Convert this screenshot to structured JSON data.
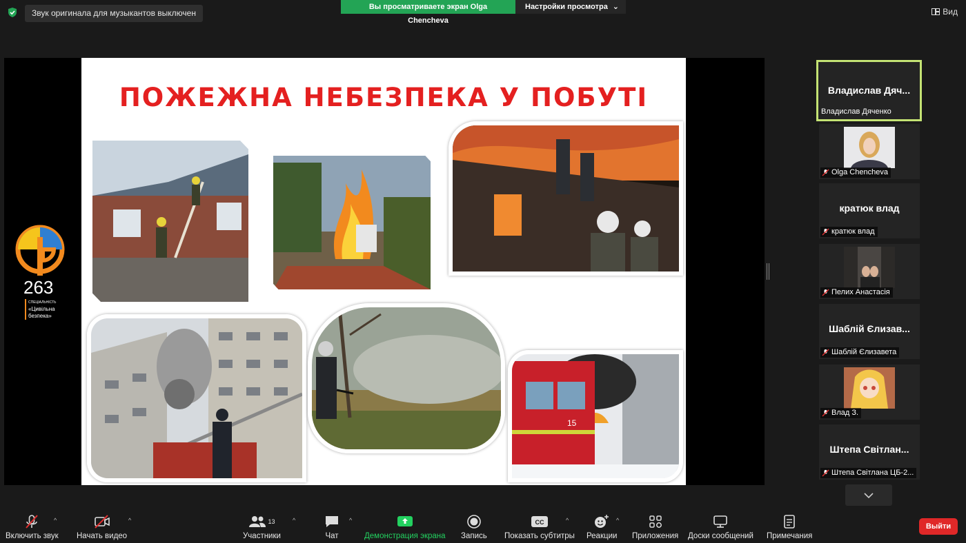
{
  "top": {
    "notice": "Звук оригинала для музыкантов выключен",
    "sharing_banner": "Вы просматриваете экран Olga Chencheva",
    "view_options": "Настройки просмотра",
    "view_button": "Вид"
  },
  "slide": {
    "title": "ПОЖЕЖНА НЕБЕЗПЕКА У ПОБУТІ",
    "logo_number": "263",
    "logo_line1": "СПЕЦІАЛЬНІСТЬ",
    "logo_line2": "«Цивільна",
    "logo_line3": "безпека»",
    "truck_number": "15"
  },
  "participants": [
    {
      "center": "Владислав Дяч...",
      "label": "Владислав Дяченко",
      "active": true,
      "muted": false
    },
    {
      "center": "",
      "label": "Olga Chencheva",
      "muted": true
    },
    {
      "center": "кратюк влад",
      "label": "кратюк влад",
      "muted": true
    },
    {
      "center": "",
      "label": "Пелих Анастасія",
      "muted": true
    },
    {
      "center": "Шаблій Єлизав...",
      "label": "Шаблій Єлизавета",
      "muted": true
    },
    {
      "center": "",
      "label": "Влад З.",
      "muted": true
    },
    {
      "center": "Штепа Світлан...",
      "label": "Штепа Світлана ЦБ-2...",
      "muted": true
    }
  ],
  "toolbar": {
    "unmute": "Включить звук",
    "start_video": "Начать видео",
    "participants": "Участники",
    "participants_count": "13",
    "chat": "Чат",
    "share_screen": "Демонстрация экрана",
    "record": "Запись",
    "captions": "Показать субтитры",
    "cc": "CC",
    "reactions": "Реакции",
    "apps": "Приложения",
    "whiteboards": "Доски сообщений",
    "notes": "Примечания",
    "leave": "Выйти"
  },
  "colors": {
    "share_green": "#23a455",
    "title_red": "#e42020",
    "active_speaker": "#c4e374",
    "leave_red": "#e02828"
  }
}
